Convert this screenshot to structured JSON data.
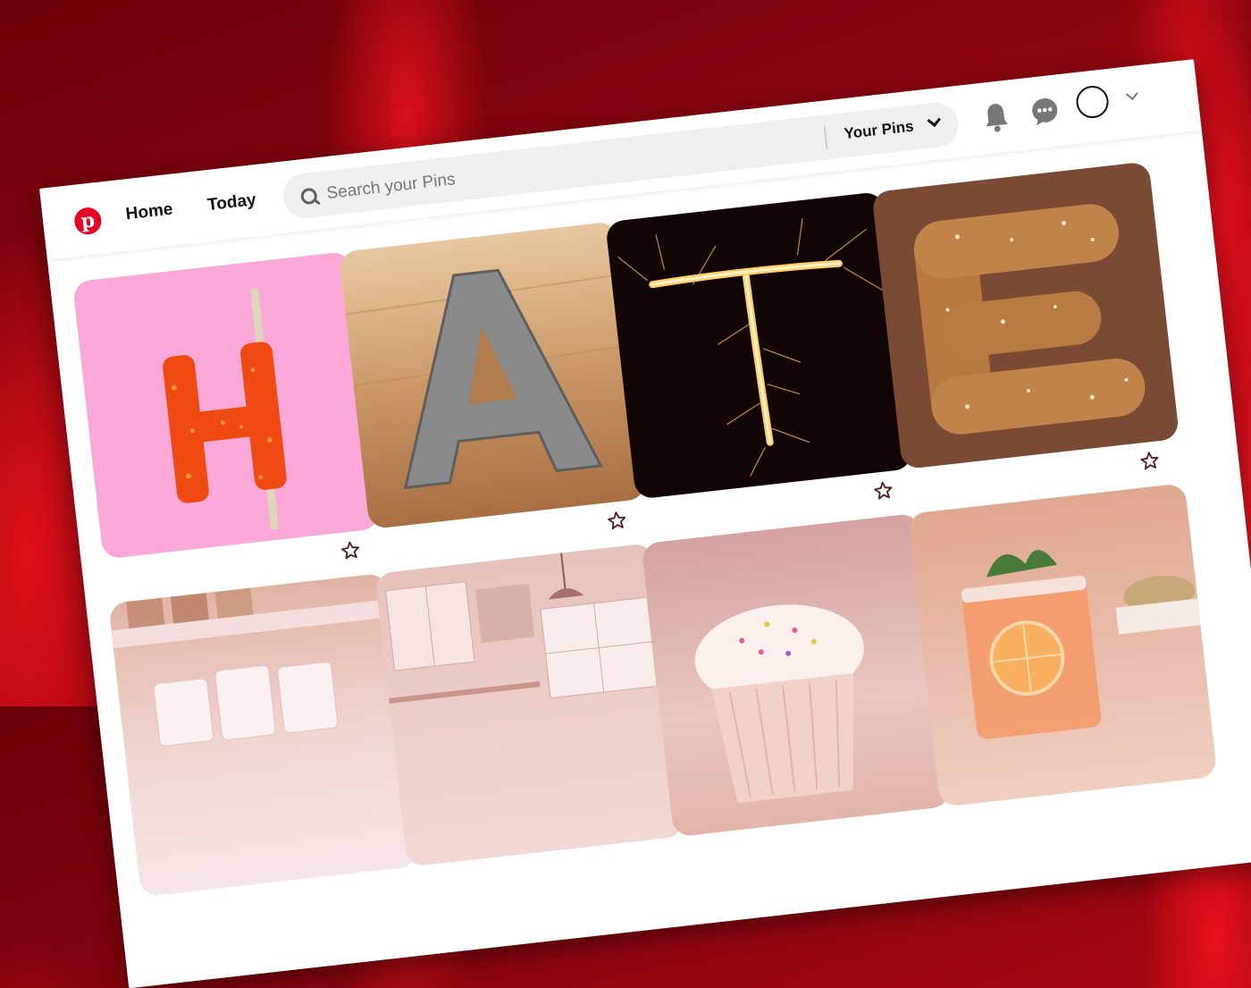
{
  "nav": {
    "home_label": "Home",
    "today_label": "Today"
  },
  "search": {
    "placeholder": "Search your Pins",
    "scope_label": "Your Pins"
  },
  "icons": {
    "logo": "pinterest-logo",
    "search": "search-icon",
    "notifications": "bell-icon",
    "messages": "chat-icon",
    "account_menu": "chevron-down-icon",
    "save": "star-icon"
  },
  "pins_row1": [
    "H",
    "A",
    "T",
    "E"
  ],
  "colors": {
    "brand": "#e60023",
    "search_bg": "#efefef"
  }
}
